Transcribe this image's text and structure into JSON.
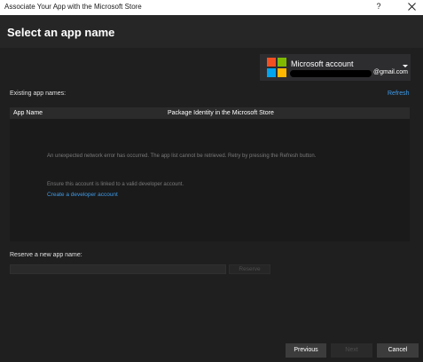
{
  "window": {
    "title": "Associate Your App with the Microsoft Store",
    "help_label": "?",
    "close_icon": "close-icon"
  },
  "header": {
    "title": "Select an app name"
  },
  "account": {
    "title": "Microsoft account",
    "email_suffix": "@gmail.com",
    "logo_icon": "microsoft-logo",
    "colors": {
      "red": "#f25022",
      "green": "#7fba00",
      "blue": "#00a4ef",
      "yellow": "#ffb900"
    }
  },
  "existing": {
    "label": "Existing app names:",
    "refresh_label": "Refresh",
    "columns": [
      "App Name",
      "Package Identity in the Microsoft Store"
    ],
    "error_text": "An unexpected network error has occurred. The app list cannot be retrieved. Retry by pressing the Refresh button.",
    "ensure_text": "Ensure this account is linked to a valid developer account.",
    "create_link": "Create a developer account"
  },
  "reserve": {
    "label": "Reserve a new app name:",
    "input_value": "",
    "button_label": "Reserve"
  },
  "footer": {
    "previous_label": "Previous",
    "next_label": "Next",
    "cancel_label": "Cancel"
  },
  "colors": {
    "link": "#3e9be8",
    "background": "#1f1f1f"
  }
}
